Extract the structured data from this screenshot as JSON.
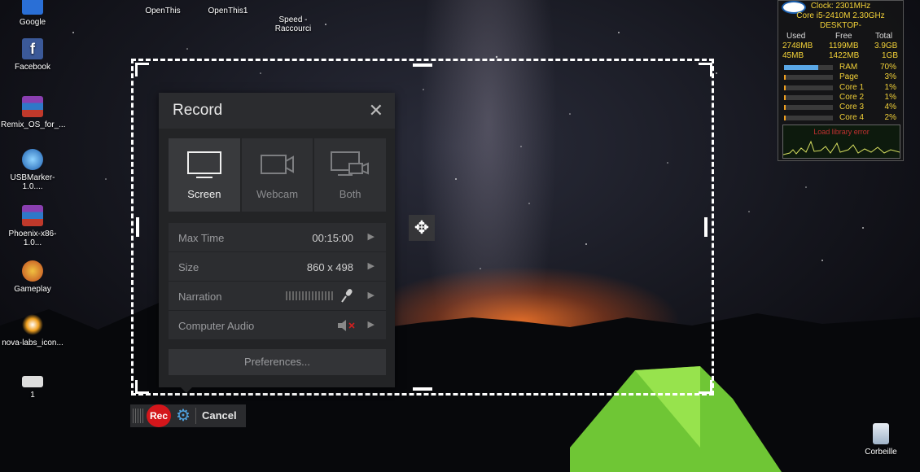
{
  "desktop_icons": [
    {
      "label": "Google"
    },
    {
      "label": "Facebook"
    },
    {
      "label": "Remix_OS_for_..."
    },
    {
      "label": "USBMarker-1.0...."
    },
    {
      "label": "Phoenix-x86-1.0..."
    },
    {
      "label": "Gameplay"
    },
    {
      "label": "nova-labs_icon..."
    },
    {
      "label": "1"
    }
  ],
  "top_icons": [
    {
      "label": "OpenThis"
    },
    {
      "label": "OpenThis1"
    },
    {
      "label": "Speed -\nRaccourci"
    }
  ],
  "recycle_bin": {
    "label": "Corbeille"
  },
  "record_panel": {
    "title": "Record",
    "modes": [
      {
        "label": "Screen",
        "active": true
      },
      {
        "label": "Webcam",
        "active": false
      },
      {
        "label": "Both",
        "active": false
      }
    ],
    "settings": [
      {
        "label": "Max Time",
        "value": "00:15:00"
      },
      {
        "label": "Size",
        "value": "860 x 498"
      },
      {
        "label": "Narration",
        "value": ""
      },
      {
        "label": "Computer Audio",
        "value": ""
      }
    ],
    "preferences_label": "Preferences..."
  },
  "toolbar": {
    "rec_label": "Rec",
    "cancel_label": "Cancel"
  },
  "gadget": {
    "clock": "Clock: 2301MHz",
    "cpu": "Core i5-2410M 2.30GHz",
    "host": "DESKTOP-",
    "headers": [
      "Used",
      "Free",
      "Total"
    ],
    "mem_row1": [
      "2748MB",
      "1199MB",
      "3.9GB"
    ],
    "mem_row2": [
      "45MB",
      "1422MB",
      "1GB"
    ],
    "meters": [
      {
        "label": "RAM",
        "value": "70%",
        "fraction": 0.7
      },
      {
        "label": "Page",
        "value": "3%",
        "fraction": 0.03
      },
      {
        "label": "Core 1",
        "value": "1%",
        "fraction": 0.01
      },
      {
        "label": "Core 2",
        "value": "1%",
        "fraction": 0.01
      },
      {
        "label": "Core 3",
        "value": "4%",
        "fraction": 0.04
      },
      {
        "label": "Core 4",
        "value": "2%",
        "fraction": 0.02
      }
    ],
    "error_text": "Load library error"
  },
  "colors": {
    "rec_red": "#d4161b",
    "gear_blue": "#4fa3e0",
    "panel_bg": "#232426",
    "gadget_yellow": "#f3d238"
  }
}
